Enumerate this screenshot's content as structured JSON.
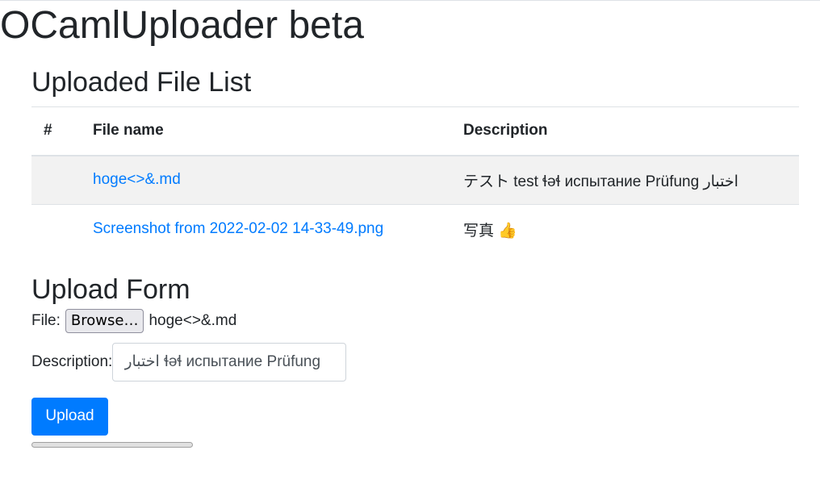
{
  "app": {
    "title": "OCamlUploader beta"
  },
  "file_list": {
    "heading": "Uploaded File List",
    "columns": [
      "#",
      "File name",
      "Description"
    ],
    "rows": [
      {
        "num": "",
        "file_name": "hoge<>&.md",
        "description": "テスト test ɬəɬ испытание Prüfung اختبار"
      },
      {
        "num": "",
        "file_name": "Screenshot from 2022-02-02 14-33-49.png",
        "description": "写真 👍"
      }
    ]
  },
  "upload_form": {
    "heading": "Upload Form",
    "file_label": "File:",
    "browse_label": "Browse…",
    "selected_file": "hoge<>&.md",
    "description_label": "Description:",
    "description_value": "ɬəɬ испытание Prüfung اختبار",
    "upload_label": "Upload",
    "progress": 0
  }
}
